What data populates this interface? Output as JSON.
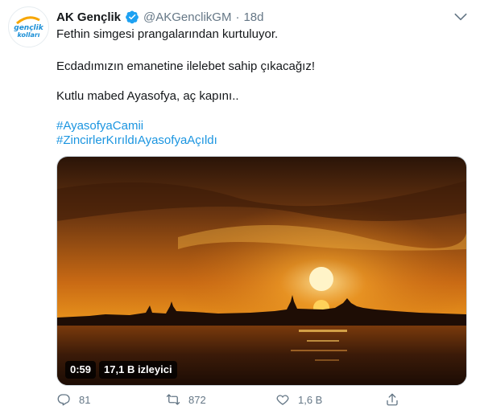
{
  "author": {
    "name": "AK Gençlik",
    "handle": "@AKGenclikGM",
    "separator": "·",
    "time": "18d",
    "avatar_logo_text": "gençlik kolları"
  },
  "tweet": {
    "line1": "Fethin simgesi prangalarından kurtuluyor.",
    "line2": "Ecdadımızın emanetine ilelebet sahip çıkacağız!",
    "line3": "Kutlu mabed Ayasofya, aç kapını..",
    "hashtag1": "#AyasofyaCamii",
    "hashtag2": "#ZincirlerKırıldıAyasofyaAçıldı"
  },
  "video": {
    "duration": "0:59",
    "views": "17,1 B izleyici"
  },
  "actions": {
    "replies": "81",
    "retweets": "872",
    "likes": "1,6 B",
    "share": ""
  },
  "colors": {
    "link": "#1b95e0",
    "muted": "#657786",
    "verified": "#1da1f2"
  },
  "icons": [
    "more-icon",
    "verified-badge-icon",
    "reply-icon",
    "retweet-icon",
    "like-icon",
    "share-icon"
  ]
}
